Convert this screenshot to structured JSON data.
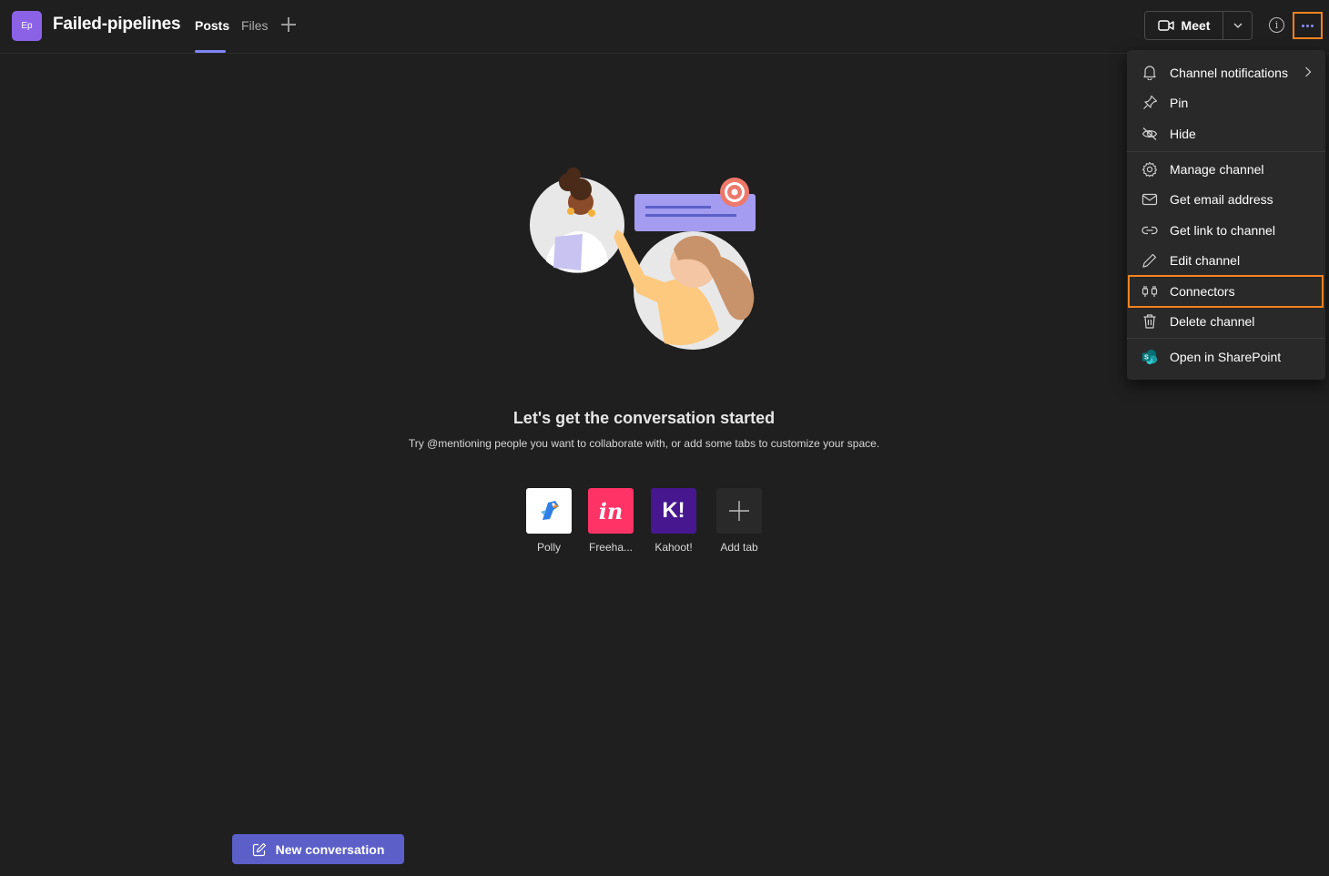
{
  "header": {
    "team_avatar": "Ep",
    "channel_title": "Failed-pipelines",
    "tabs": [
      {
        "label": "Posts"
      },
      {
        "label": "Files"
      }
    ],
    "meet_label": "Meet",
    "info_icon": "i",
    "accent_color": "#7f85f5"
  },
  "menu": {
    "items": [
      {
        "label": "Channel notifications",
        "icon": "bell-icon"
      },
      {
        "label": "Pin",
        "icon": "pin-icon"
      },
      {
        "label": "Hide",
        "icon": "eye-off-icon"
      },
      {
        "label": "Manage channel",
        "icon": "gear-icon"
      },
      {
        "label": "Get email address",
        "icon": "mail-icon"
      },
      {
        "label": "Get link to channel",
        "icon": "link-icon"
      },
      {
        "label": "Edit channel",
        "icon": "pencil-icon"
      },
      {
        "label": "Connectors",
        "icon": "connector-icon"
      },
      {
        "label": "Delete channel",
        "icon": "trash-icon"
      },
      {
        "label": "Open in SharePoint",
        "icon": "sharepoint-icon"
      }
    ],
    "highlight_color": "#f58220"
  },
  "empty_state": {
    "title": "Let's get the conversation started",
    "subtitle": "Try @mentioning people you want to collaborate with, or add some tabs to customize your space."
  },
  "apps": [
    {
      "label": "Polly",
      "icon": "polly-icon"
    },
    {
      "label": "Freeha...",
      "icon": "invision-icon",
      "glyph": "in"
    },
    {
      "label": "Kahoot!",
      "icon": "kahoot-icon",
      "glyph": "K!"
    },
    {
      "label": "Add tab",
      "icon": "plus-icon"
    }
  ],
  "compose": {
    "new_conversation_label": "New conversation",
    "button_color": "#5b5fc7"
  }
}
